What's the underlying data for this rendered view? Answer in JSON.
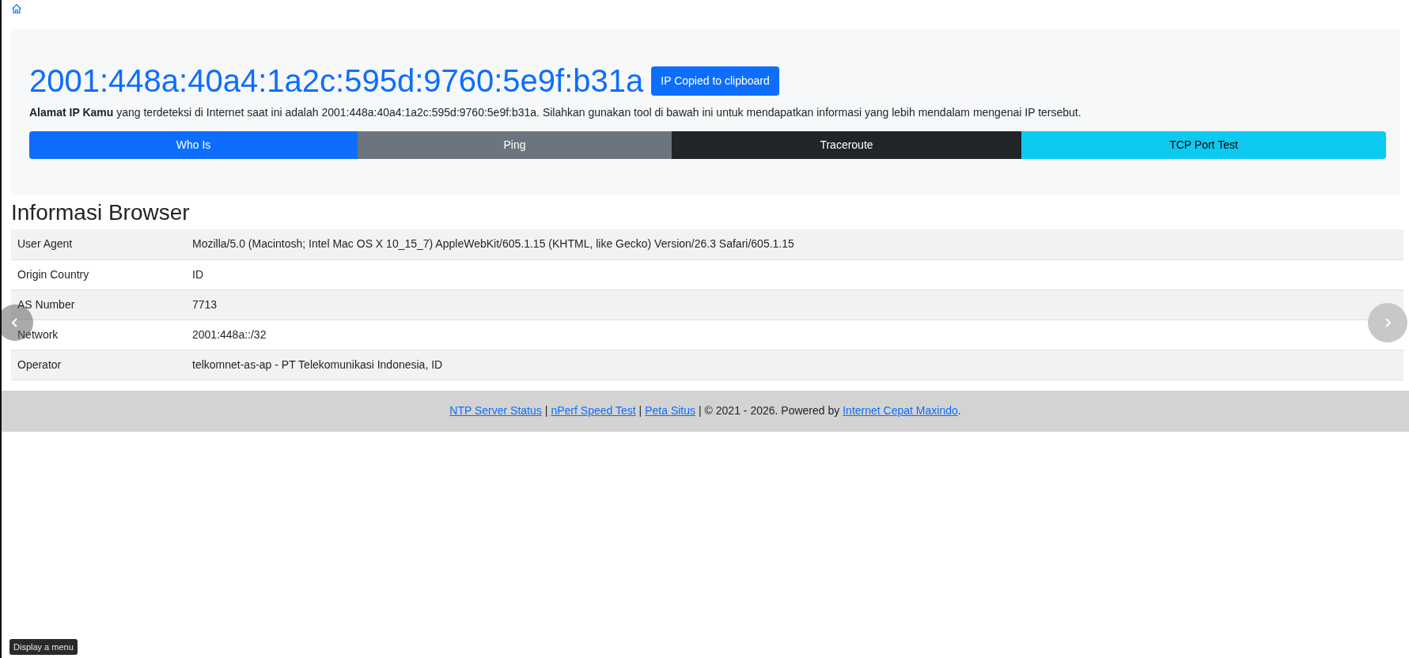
{
  "header": {
    "ip": "2001:448a:40a4:1a2c:595d:9760:5e9f:b31a",
    "copy_button": "IP Copied to clipboard",
    "description": "**Alamat IP Kamu** yang terdeteksi di Internet saat ini adalah 2001:448a:40a4:1a2c:595d:9760:5e9f:b31a. Silahkan gunakan tool di bawah ini untuk mendapatkan informasi yang lebih mendalam mengenai IP tersebut."
  },
  "tools": [
    {
      "label": "Who Is",
      "kind": "primary"
    },
    {
      "label": "Ping",
      "kind": "secondary"
    },
    {
      "label": "Traceroute",
      "kind": "dark"
    },
    {
      "label": "TCP Port Test",
      "kind": "info"
    }
  ],
  "browser_info": {
    "title": "Informasi Browser",
    "rows": [
      {
        "label": "User Agent",
        "value": "Mozilla/5.0 (Macintosh; Intel Mac OS X 10_15_7) AppleWebKit/605.1.15 (KHTML, like Gecko) Version/26.3 Safari/605.1.15"
      },
      {
        "label": "Origin Country",
        "value": "ID"
      },
      {
        "label": "AS Number",
        "value": "7713"
      },
      {
        "label": "Network",
        "value": "2001:448a::/32"
      },
      {
        "label": "Operator",
        "value": "telkomnet-as-ap - PT Telekomunikasi Indonesia, ID"
      }
    ]
  },
  "footer": {
    "links": [
      "NTP Server Status",
      "nPerf Speed Test",
      "Peta Situs"
    ],
    "separator": "|",
    "copyright": "| © 2021 - 2026. Powered by",
    "powered_link": "Internet Cepat Maxindo",
    "end": "."
  },
  "tooltip": "Display a menu"
}
